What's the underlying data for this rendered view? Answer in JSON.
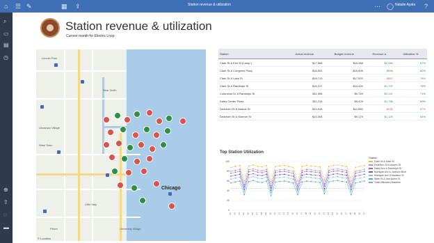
{
  "window": {
    "title": "Station revenue & utilization",
    "user": "Natalie Ayala"
  },
  "header": {
    "title": "Station revenue & utilization",
    "subtitle": "Current month for Electric Loop"
  },
  "map": {
    "city_label": "Chicago",
    "attribution": "© Location",
    "labels": [
      "Lincoln Park",
      "Near North",
      "Ukrainian Village",
      "West Town",
      "Little Italy",
      "Pilsen",
      "University Village"
    ]
  },
  "table": {
    "columns": [
      "Station",
      "Actual revenue",
      "Budget revenue",
      "Revenue Δ",
      "Utilization %"
    ],
    "rows": [
      {
        "station": "Clark St & Elm St (Lamp.)",
        "actual": "$17,568",
        "budget": "$15,488",
        "delta": "$2,080",
        "util": "87%",
        "status": "pos"
      },
      {
        "station": "Clark St & Congress Pkwy",
        "actual": "$16,902",
        "budget": "$15,906",
        "delta": "$996",
        "util": "82%",
        "status": "pos"
      },
      {
        "station": "Clark St & Lake St",
        "actual": "$16,713",
        "budget": "$17,520",
        "delta": "-$807",
        "util": "78%",
        "status": "neg"
      },
      {
        "station": "Clark St & Randolph St",
        "actual": "$16,217",
        "budget": "$14,420",
        "delta": "$1,797",
        "util": "76%",
        "status": "pos"
      },
      {
        "station": "Columbus Dr & Randolph St",
        "actual": "$11,996",
        "budget": "$9,749",
        "delta": "$2,247",
        "util": "71%",
        "status": "pos"
      },
      {
        "station": "Daley Center Plaza",
        "actual": "$11,215",
        "budget": "$9,429",
        "delta": "$1,786",
        "util": "69%",
        "status": "pos"
      },
      {
        "station": "Dearborn St & Adams St",
        "actual": "$10,918",
        "budget": "$11,850",
        "delta": "-$932",
        "util": "67%",
        "status": "neg"
      },
      {
        "station": "Dearborn St & Monroe St",
        "actual": "$10,304",
        "budget": "$9,179",
        "delta": "$1,125",
        "util": "64%",
        "status": "pos"
      }
    ]
  },
  "chart_data": {
    "type": "line",
    "title": "Top Station Utilization",
    "x": [
      "01",
      "02",
      "03",
      "04",
      "05",
      "06",
      "07",
      "08",
      "09",
      "10",
      "11",
      "12",
      "13",
      "14",
      "15",
      "16",
      "17",
      "18",
      "19",
      "20",
      "21",
      "22",
      "23",
      "24",
      "25",
      "26",
      "27",
      "28",
      "29",
      "30",
      "31"
    ],
    "ylim": [
      0,
      100
    ],
    "yticks": [
      0,
      20,
      40,
      60,
      80,
      100
    ],
    "legend_title": "Station",
    "series": [
      {
        "name": "Clark St & Lake St",
        "color": "#f4b942",
        "values": [
          88,
          90,
          92,
          60,
          91,
          93,
          90,
          89,
          92,
          58,
          90,
          91,
          92,
          90,
          88,
          60,
          90,
          92,
          91,
          90,
          89,
          62,
          90,
          92,
          93,
          91,
          90,
          60,
          88,
          90,
          92
        ]
      },
      {
        "name": "Dearborn St & Adams St",
        "color": "#b38de0",
        "values": [
          80,
          82,
          84,
          52,
          83,
          85,
          82,
          81,
          84,
          50,
          82,
          83,
          84,
          82,
          80,
          52,
          82,
          84,
          83,
          82,
          81,
          54,
          82,
          84,
          85,
          83,
          82,
          52,
          80,
          82,
          84
        ]
      },
      {
        "name": "Daley Ave & Randolph St",
        "color": "#8c6bc8",
        "values": [
          76,
          78,
          80,
          48,
          79,
          81,
          78,
          77,
          80,
          46,
          78,
          79,
          80,
          78,
          76,
          48,
          78,
          80,
          79,
          78,
          77,
          50,
          78,
          80,
          81,
          79,
          78,
          48,
          76,
          78,
          80
        ]
      },
      {
        "name": "Michigan Ave & Jackson Blvd",
        "color": "#6e5bb8",
        "values": [
          70,
          72,
          74,
          42,
          73,
          75,
          72,
          71,
          74,
          40,
          72,
          73,
          74,
          72,
          70,
          42,
          72,
          74,
          73,
          72,
          71,
          44,
          72,
          74,
          75,
          73,
          72,
          42,
          70,
          72,
          74
        ]
      },
      {
        "name": "Michigan Ave & Madison St",
        "color": "#7fc3e6",
        "values": [
          64,
          66,
          68,
          38,
          67,
          69,
          66,
          65,
          68,
          36,
          66,
          67,
          68,
          66,
          64,
          38,
          66,
          68,
          67,
          66,
          65,
          40,
          66,
          68,
          69,
          67,
          66,
          38,
          64,
          66,
          68
        ]
      },
      {
        "name": "State St & Van Buren St",
        "color": "#4ab0a0",
        "values": [
          56,
          58,
          60,
          32,
          59,
          61,
          58,
          57,
          60,
          30,
          58,
          59,
          60,
          58,
          56,
          32,
          58,
          60,
          59,
          58,
          57,
          34,
          58,
          60,
          61,
          59,
          58,
          32,
          56,
          58,
          60
        ]
      }
    ],
    "reference": {
      "name": "Total Utilization Baseline",
      "color": "#9aa3ad",
      "value": 45
    }
  },
  "colors": {
    "topbar": "#3f6fb5",
    "sidebar": "#2f3a4d",
    "positive": "#2f8f46",
    "negative": "#d9534f"
  }
}
